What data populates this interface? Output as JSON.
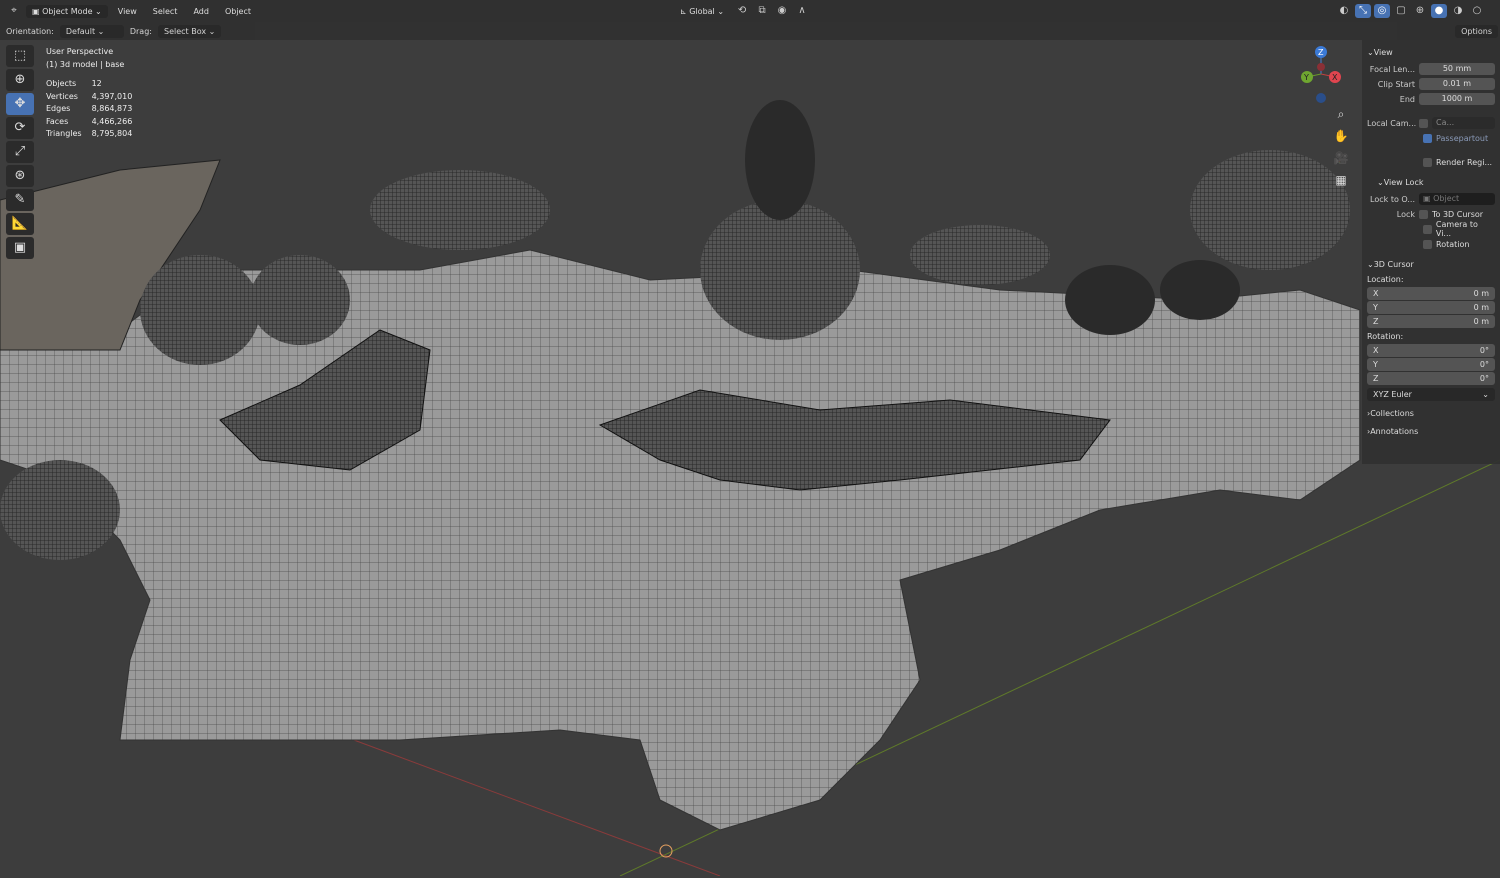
{
  "header": {
    "mode": "Object Mode",
    "menus": [
      "View",
      "Select",
      "Add",
      "Object"
    ],
    "transform_orientation": "Global",
    "options": "Options"
  },
  "toolsettings": {
    "orientation_label": "Orientation:",
    "orientation_value": "Default",
    "drag_label": "Drag:",
    "drag_value": "Select Box"
  },
  "overlay": {
    "view_name": "User Perspective",
    "collection": "(1) 3d model | base",
    "stats": [
      {
        "k": "Objects",
        "v": "12"
      },
      {
        "k": "Vertices",
        "v": "4,397,010"
      },
      {
        "k": "Edges",
        "v": "8,864,873"
      },
      {
        "k": "Faces",
        "v": "4,466,266"
      },
      {
        "k": "Triangles",
        "v": "8,795,804"
      }
    ]
  },
  "gizmo": {
    "x": "X",
    "y": "Y",
    "z": "Z"
  },
  "sidebar": {
    "view": {
      "title": "View",
      "focal_label": "Focal Len...",
      "focal": "50 mm",
      "clip_start_label": "Clip Start",
      "clip_start": "0.01 m",
      "end_label": "End",
      "end": "1000 m",
      "local_cam_label": "Local Cam...",
      "local_cam": "Ca...",
      "passepartout": "Passepartout",
      "render_region": "Render Regi..."
    },
    "view_lock": {
      "title": "View Lock",
      "lock_to_label": "Lock to O...",
      "lock_to": "Object",
      "lock_label": "Lock",
      "to_cursor": "To 3D Cursor",
      "camera_to_view": "Camera to Vi...",
      "rotation": "Rotation"
    },
    "cursor": {
      "title": "3D Cursor",
      "location_label": "Location:",
      "loc": [
        {
          "a": "X",
          "v": "0 m"
        },
        {
          "a": "Y",
          "v": "0 m"
        },
        {
          "a": "Z",
          "v": "0 m"
        }
      ],
      "rotation_label": "Rotation:",
      "rot": [
        {
          "a": "X",
          "v": "0°"
        },
        {
          "a": "Y",
          "v": "0°"
        },
        {
          "a": "Z",
          "v": "0°"
        }
      ],
      "mode": "XYZ Euler"
    },
    "collections": "Collections",
    "annotations": "Annotations"
  }
}
